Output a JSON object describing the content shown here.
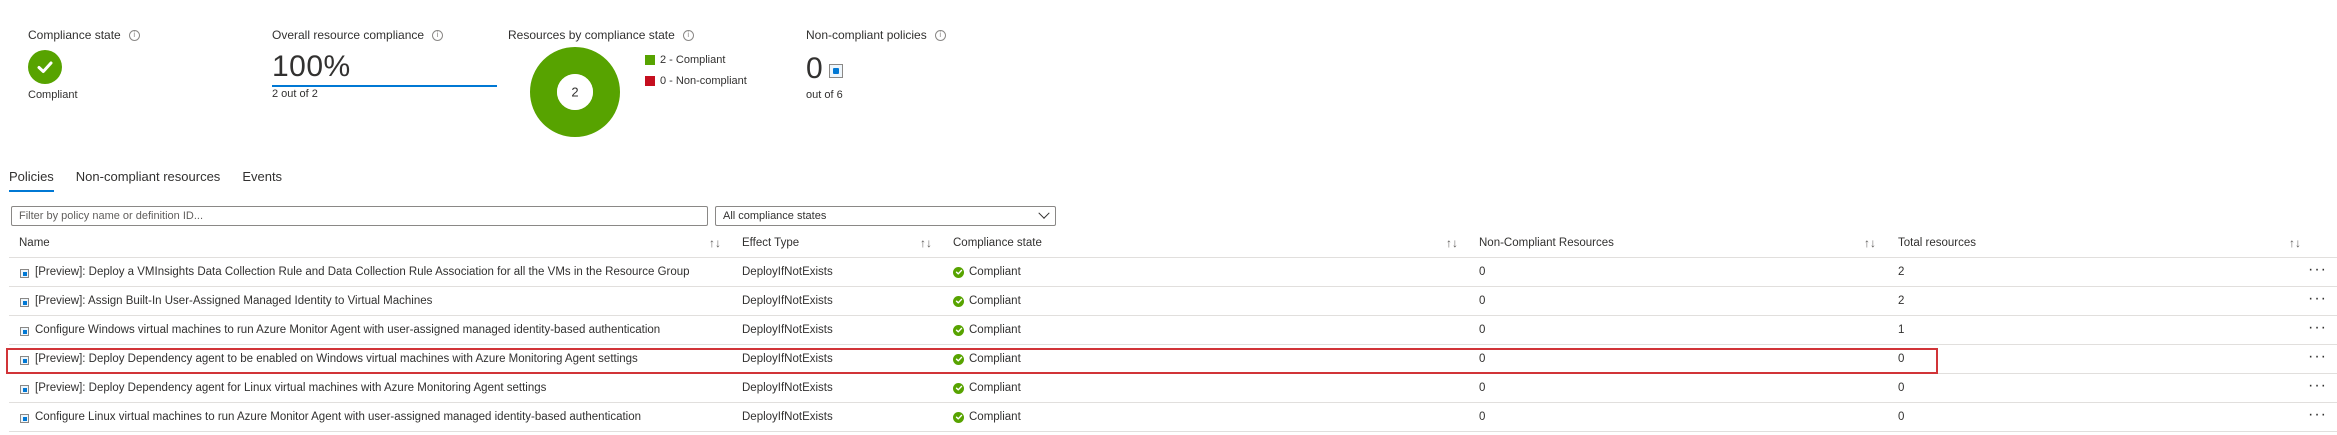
{
  "summary": {
    "compliance_state": {
      "title": "Compliance state",
      "value": "Compliant"
    },
    "overall": {
      "title": "Overall resource compliance",
      "percent_label": "100%",
      "percent": 100,
      "subtitle": "2 out of 2"
    },
    "by_state": {
      "title": "Resources by compliance state",
      "total_label": "2",
      "legend": [
        {
          "label": "2 - Compliant",
          "color": "#57a300",
          "count": 2
        },
        {
          "label": "0 - Non-compliant",
          "color": "#c50f1f",
          "count": 0
        }
      ]
    },
    "noncompliant_policies": {
      "title": "Non-compliant policies",
      "value": "0",
      "subtitle": "out of 6"
    }
  },
  "tabs": [
    {
      "label": "Policies",
      "active": true
    },
    {
      "label": "Non-compliant resources",
      "active": false
    },
    {
      "label": "Events",
      "active": false
    }
  ],
  "filters": {
    "search_placeholder": "Filter by policy name or definition ID...",
    "state_selected": "All compliance states"
  },
  "table": {
    "columns": [
      "Name",
      "Effect Type",
      "Compliance state",
      "Non-Compliant Resources",
      "Total resources"
    ],
    "sort_icon": "↑↓",
    "more_label": "···",
    "rows": [
      {
        "name": "[Preview]: Deploy a VMInsights Data Collection Rule and Data Collection Rule Association for all the VMs in the Resource Group",
        "effect": "DeployIfNotExists",
        "state": "Compliant",
        "noncompliant": "0",
        "total": "2",
        "highlight": false
      },
      {
        "name": "[Preview]: Assign Built-In User-Assigned Managed Identity to Virtual Machines",
        "effect": "DeployIfNotExists",
        "state": "Compliant",
        "noncompliant": "0",
        "total": "2",
        "highlight": false
      },
      {
        "name": "Configure Windows virtual machines to run Azure Monitor Agent with user-assigned managed identity-based authentication",
        "effect": "DeployIfNotExists",
        "state": "Compliant",
        "noncompliant": "0",
        "total": "1",
        "highlight": false
      },
      {
        "name": "[Preview]: Deploy Dependency agent to be enabled on Windows virtual machines with Azure Monitoring Agent settings",
        "effect": "DeployIfNotExists",
        "state": "Compliant",
        "noncompliant": "0",
        "total": "0",
        "highlight": true
      },
      {
        "name": "[Preview]: Deploy Dependency agent for Linux virtual machines with Azure Monitoring Agent settings",
        "effect": "DeployIfNotExists",
        "state": "Compliant",
        "noncompliant": "0",
        "total": "0",
        "highlight": false
      },
      {
        "name": "Configure Linux virtual machines to run Azure Monitor Agent with user-assigned managed identity-based authentication",
        "effect": "DeployIfNotExists",
        "state": "Compliant",
        "noncompliant": "0",
        "total": "0",
        "highlight": false
      }
    ]
  },
  "colors": {
    "accent": "#0078d4",
    "compliant": "#57a300",
    "noncompliant": "#c50f1f",
    "highlight_border": "#d13438"
  }
}
